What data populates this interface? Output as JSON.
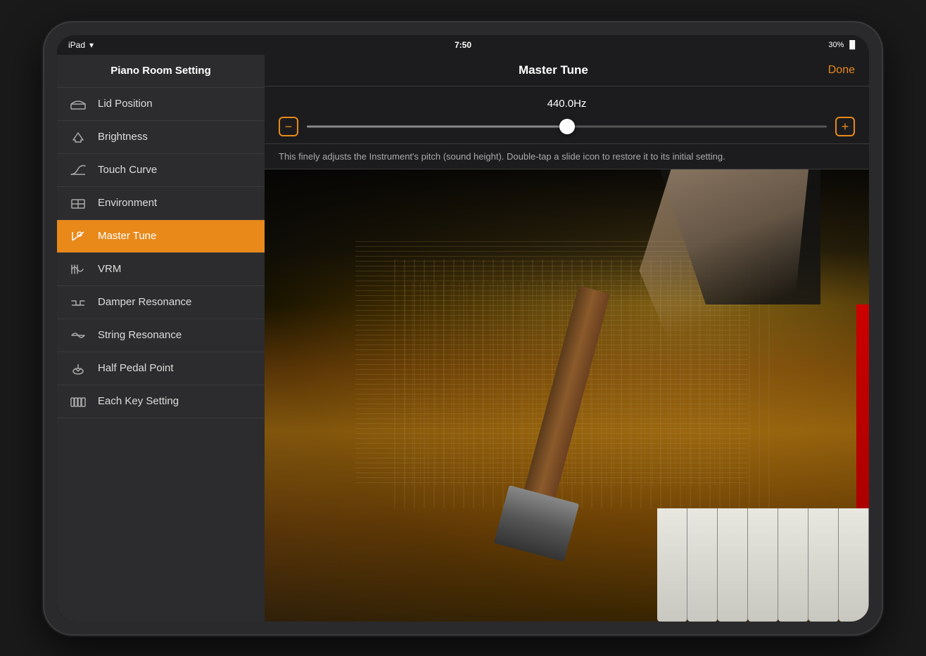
{
  "device": {
    "status_bar": {
      "left_text": "iPad",
      "time": "7:50",
      "battery": "30%",
      "battery_icon": "🔋"
    }
  },
  "sidebar": {
    "header": "Piano Room Setting",
    "items": [
      {
        "id": "lid-position",
        "label": "Lid Position",
        "active": false,
        "icon": "lid"
      },
      {
        "id": "brightness",
        "label": "Brightness",
        "active": false,
        "icon": "brightness"
      },
      {
        "id": "touch-curve",
        "label": "Touch Curve",
        "active": false,
        "icon": "touch"
      },
      {
        "id": "environment",
        "label": "Environment",
        "active": false,
        "icon": "environment"
      },
      {
        "id": "master-tune",
        "label": "Master Tune",
        "active": true,
        "icon": "tune"
      },
      {
        "id": "vrm",
        "label": "VRM",
        "active": false,
        "icon": "vrm"
      },
      {
        "id": "damper-resonance",
        "label": "Damper Resonance",
        "active": false,
        "icon": "damper"
      },
      {
        "id": "string-resonance",
        "label": "String Resonance",
        "active": false,
        "icon": "string"
      },
      {
        "id": "half-pedal",
        "label": "Half Pedal Point",
        "active": false,
        "icon": "pedal"
      },
      {
        "id": "each-key",
        "label": "Each Key Setting",
        "active": false,
        "icon": "key"
      }
    ]
  },
  "main": {
    "title": "Master Tune",
    "done_button": "Done",
    "slider": {
      "value": "440.0Hz",
      "min_icon": "−",
      "max_icon": "+",
      "position": 50
    },
    "description": "This finely adjusts the Instrument's pitch (sound height). Double-tap a slide icon to restore it to its initial setting."
  }
}
